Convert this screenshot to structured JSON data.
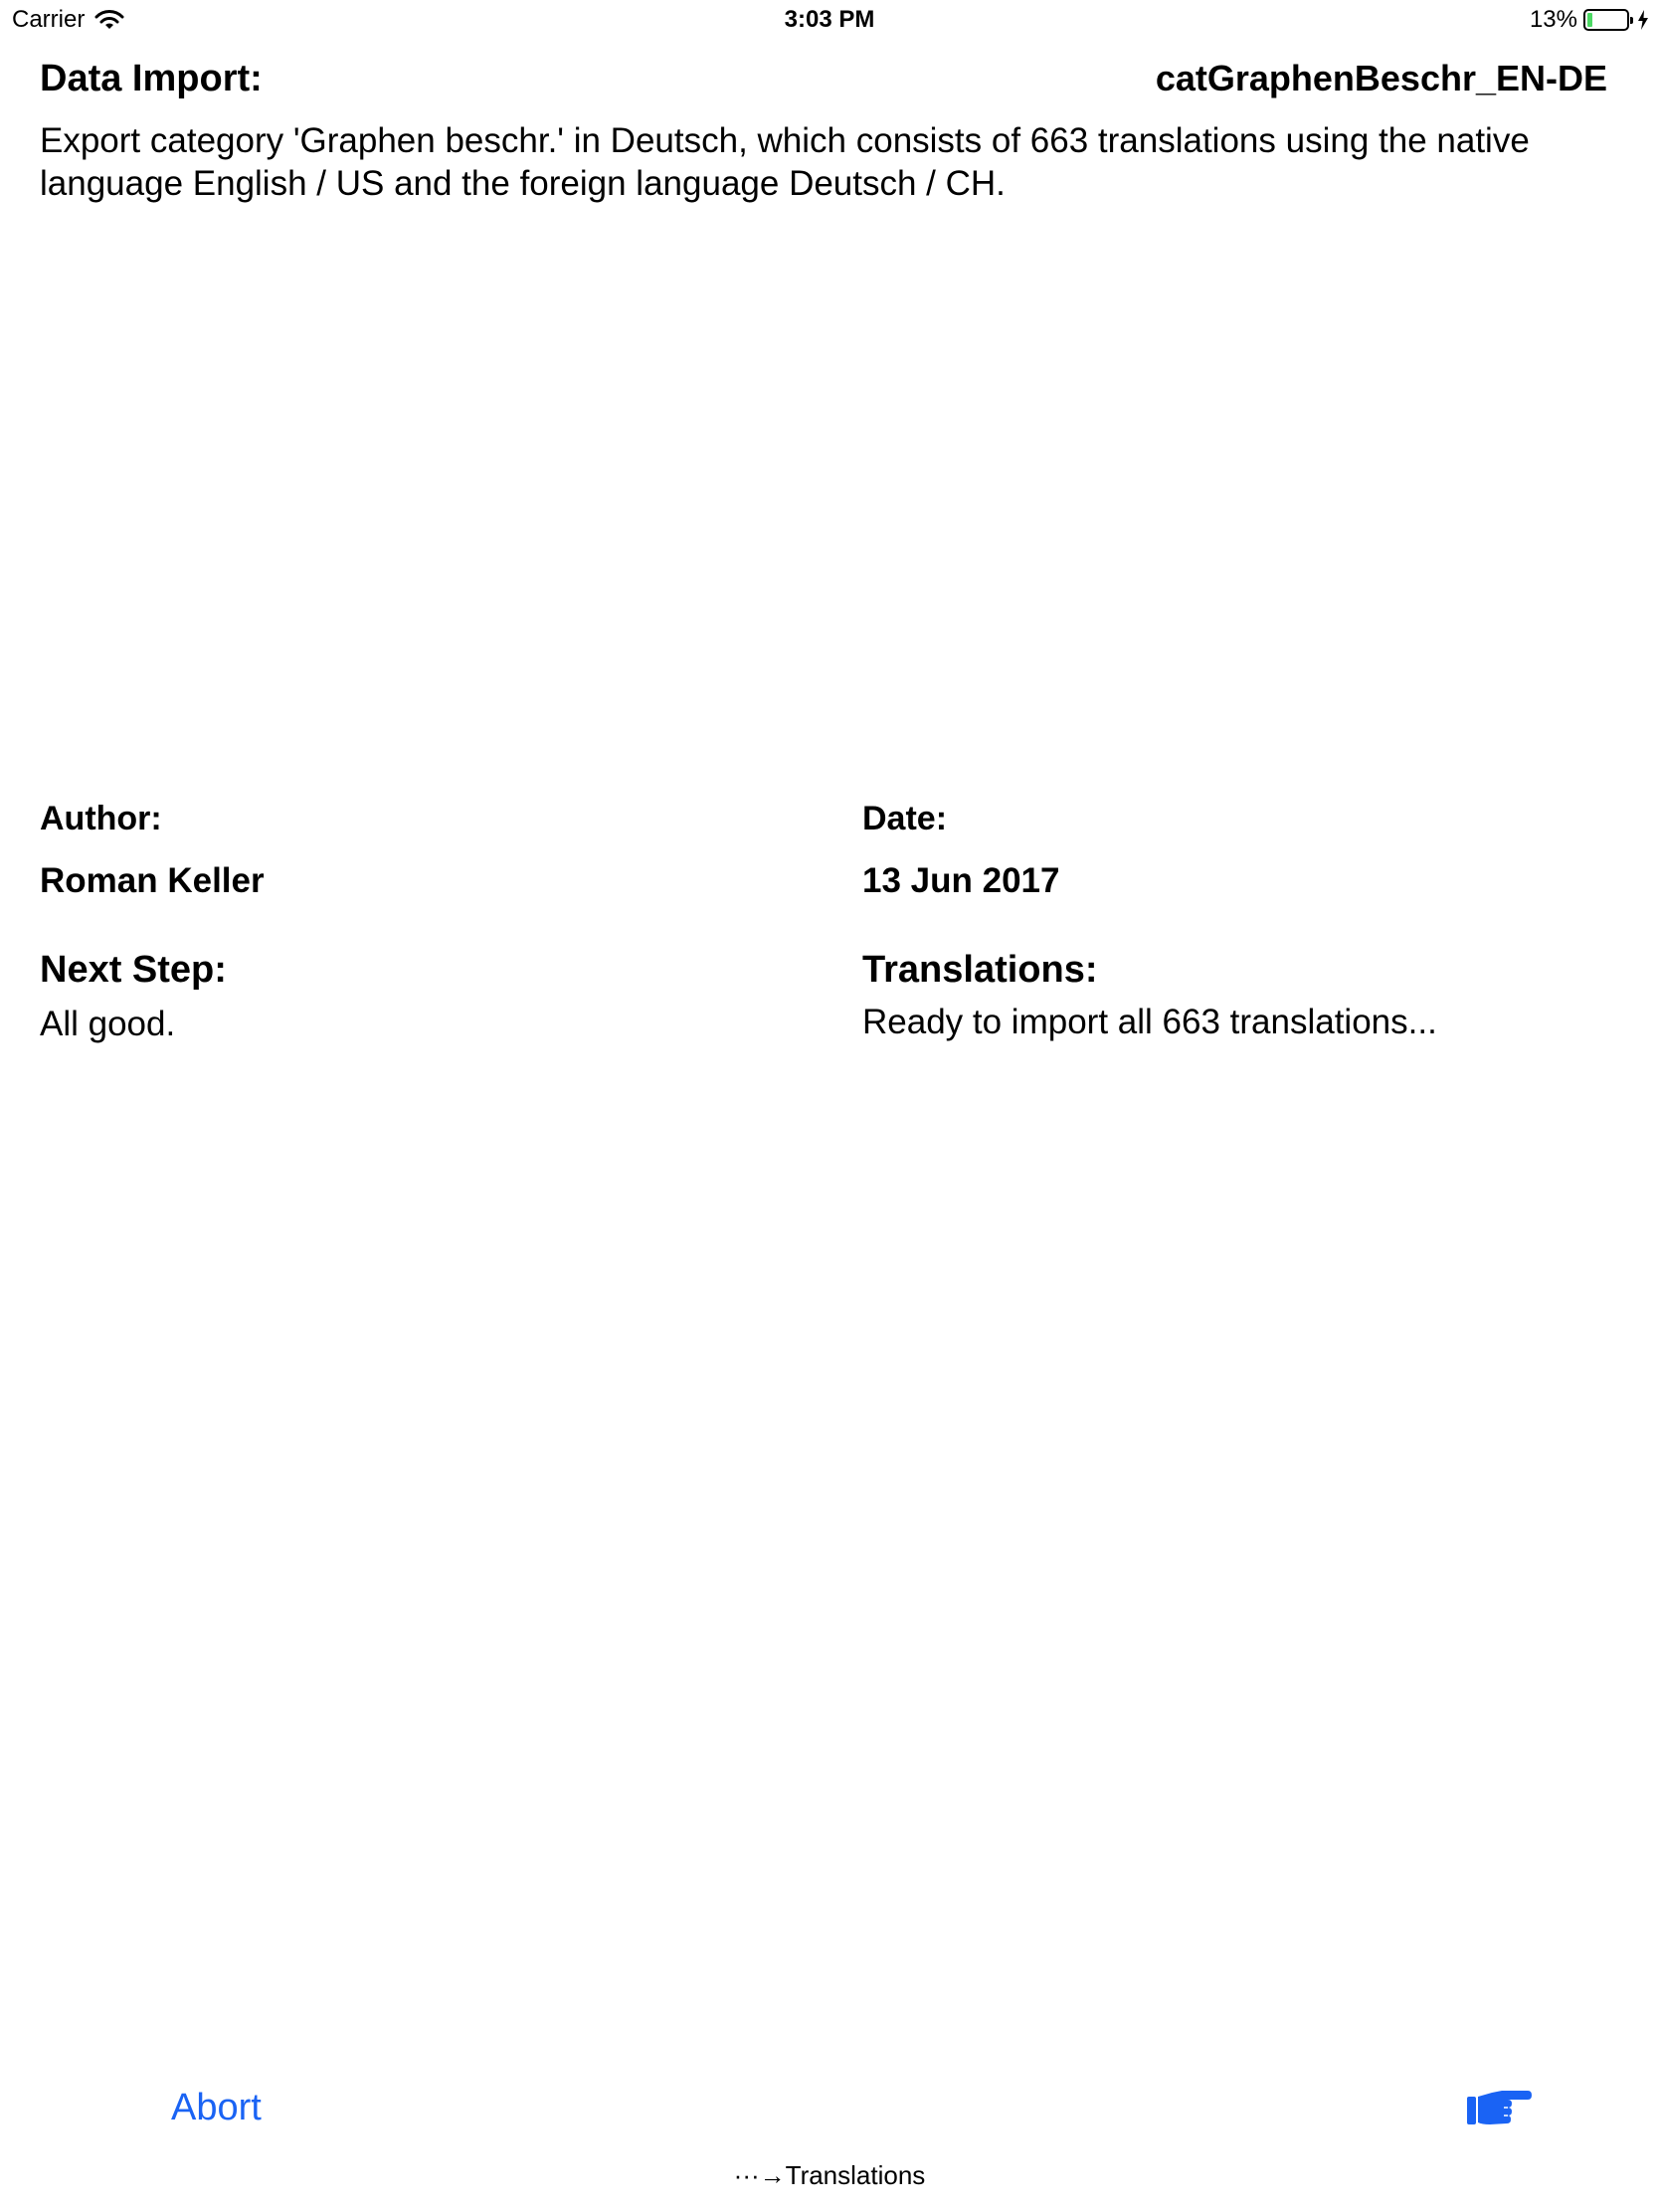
{
  "status_bar": {
    "carrier": "Carrier",
    "time": "3:03 PM",
    "battery_percent": "13%",
    "battery_level": 0.13,
    "battery_fill_color": "#4cd964",
    "icons": [
      "wifi-icon",
      "battery-icon",
      "charging-icon"
    ]
  },
  "header": {
    "label": "Data Import:",
    "filename": "catGraphenBeschr_EN-DE",
    "description": "Export category 'Graphen beschr.' in Deutsch, which consists of 663 translations using the native language English / US and the foreign language Deutsch / CH."
  },
  "info": {
    "author_label": "Author:",
    "author_value": "Roman Keller",
    "date_label": "Date:",
    "date_value": "13 Jun 2017",
    "next_step_label": "Next Step:",
    "next_step_value": "All good.",
    "translations_label": "Translations:",
    "translations_value": "Ready to import all 663 translations..."
  },
  "toolbar": {
    "abort_label": "Abort",
    "next_icon": "pointing-hand-icon",
    "accent_color": "#1a63f4"
  },
  "footer": {
    "label": "···→Translations"
  }
}
